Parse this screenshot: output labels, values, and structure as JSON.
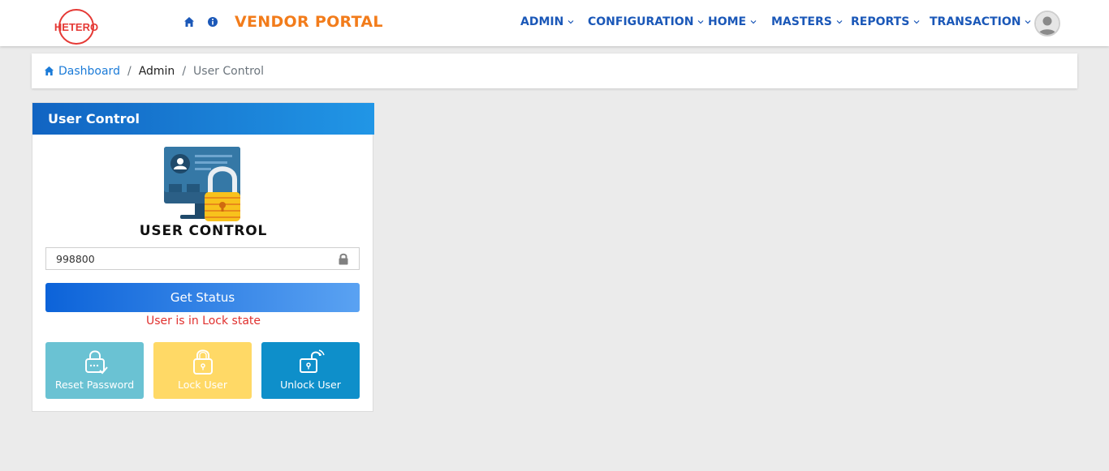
{
  "app": {
    "logo_text": "HETERO",
    "brand": "VENDOR PORTAL"
  },
  "nav": {
    "menus": [
      "ADMIN",
      "CONFIGURATION",
      "HOME",
      "MASTERS",
      "REPORTS",
      "TRANSACTION"
    ]
  },
  "breadcrumb": {
    "home": "Dashboard",
    "sep": "/",
    "admin": "Admin",
    "current": "User Control"
  },
  "card": {
    "header": "User Control",
    "title": "USER CONTROL",
    "user_value": "998800",
    "get_status_label": "Get Status",
    "status_message": "User is in Lock state",
    "actions": {
      "reset": "Reset Password",
      "lock": "Lock User",
      "unlock": "Unlock User"
    }
  },
  "icons": {
    "home": "home-icon",
    "info": "info-icon",
    "chevron": "chevron-down-icon",
    "avatar": "user-avatar-icon",
    "lock": "lock-icon",
    "unlock": "unlock-icon"
  },
  "colors": {
    "brand": "#f27c1b",
    "nav": "#1b58b8",
    "status_error": "#e0302e",
    "reset": "#6ac2d3",
    "lock": "#ffd966",
    "unlock": "#0e8fca"
  }
}
